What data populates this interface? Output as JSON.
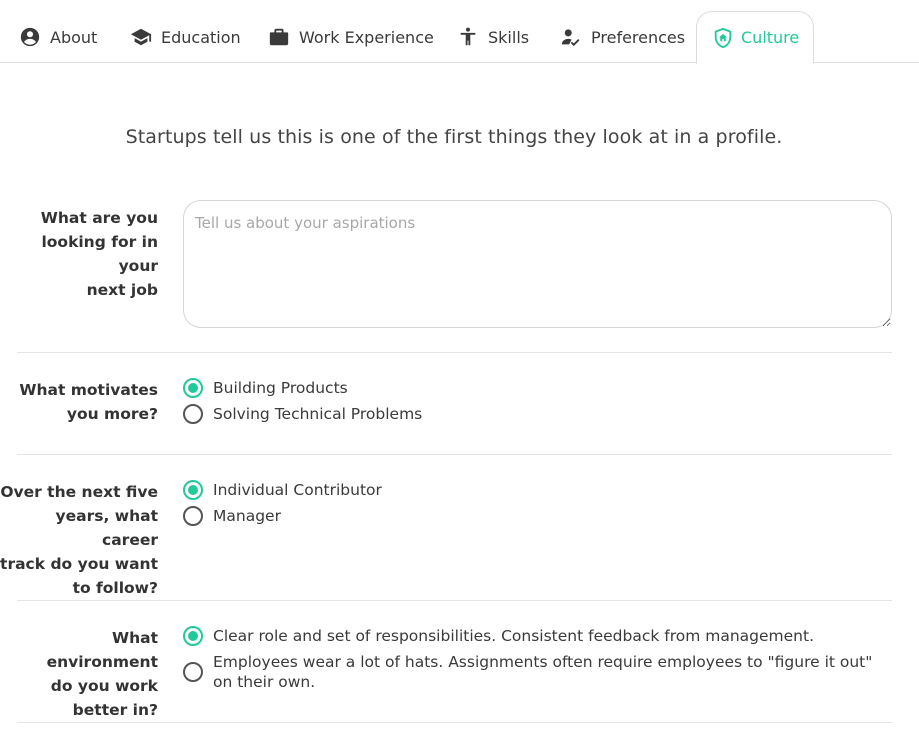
{
  "tabs": [
    {
      "label": "About",
      "icon": "account-circle-icon"
    },
    {
      "label": "Education",
      "icon": "graduation-cap-icon"
    },
    {
      "label": "Work Experience",
      "icon": "briefcase-icon"
    },
    {
      "label": "Skills",
      "icon": "person-accessibility-icon"
    },
    {
      "label": "Preferences",
      "icon": "person-check-icon"
    },
    {
      "label": "Culture",
      "icon": "shield-home-icon",
      "active": true
    }
  ],
  "accent_color": "#22c99a",
  "intro": "Startups tell us this is one of the first things they look at in a profile.",
  "aspirations": {
    "label_lines": [
      "What are you",
      "looking for in your",
      "next job"
    ],
    "value": "",
    "placeholder": "Tell us about your aspirations"
  },
  "motivation": {
    "label_lines": [
      "What motivates",
      "you more?"
    ],
    "options": [
      {
        "label": "Building Products",
        "checked": true
      },
      {
        "label": "Solving Technical Problems",
        "checked": false
      }
    ]
  },
  "career_track": {
    "label_lines": [
      "Over the next five",
      "years, what career",
      "track do you want",
      "to follow?"
    ],
    "options": [
      {
        "label": "Individual Contributor",
        "checked": true
      },
      {
        "label": "Manager",
        "checked": false
      }
    ]
  },
  "environment": {
    "label_lines": [
      "What environment",
      "do you work",
      "better in?"
    ],
    "options": [
      {
        "label": "Clear role and set of responsibilities. Consistent feedback from management.",
        "checked": true
      },
      {
        "label": "Employees wear a lot of hats. Assignments often require employees to \"figure it out\" on their own.",
        "checked": false
      }
    ]
  }
}
